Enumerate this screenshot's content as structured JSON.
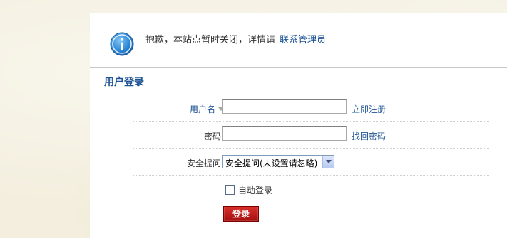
{
  "notice": {
    "text": "抱歉，本站点暂时关闭，详情请",
    "link_label": "联系管理员"
  },
  "login": {
    "title": "用户登录",
    "username_label": "用户名",
    "username_value": "",
    "register_link": "立即注册",
    "password_label": "密码:",
    "password_value": "",
    "recover_link": "找回密码",
    "question_label": "安全提问:",
    "question_selected": "安全提问(未设置请忽略)",
    "auto_login_label": "自动登录",
    "submit_label": "登录"
  },
  "colors": {
    "link": "#1e5494",
    "button": "#b5171a",
    "background": "#f3eedd"
  },
  "icons": {
    "notice": "info-icon",
    "username_dropdown": "dropdown-arrow-icon",
    "select": "chevron-down-icon"
  }
}
